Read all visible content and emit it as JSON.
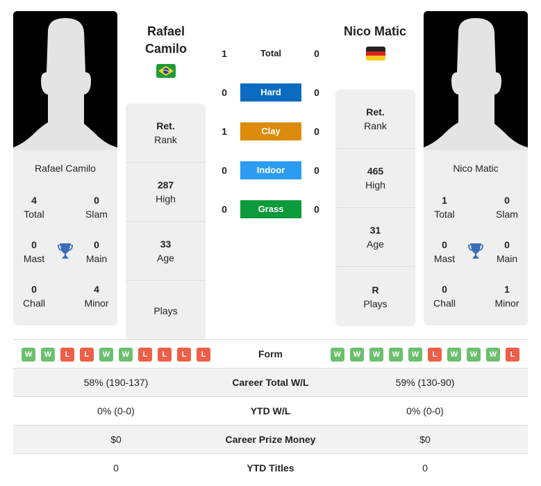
{
  "player1": {
    "name": "Rafael Camilo",
    "name_line1": "Rafael",
    "name_line2": "Camilo",
    "flag": "brazil-flag",
    "titles": {
      "total": "4",
      "total_label": "Total",
      "slam": "0",
      "slam_label": "Slam",
      "mast": "0",
      "mast_label": "Mast",
      "main": "0",
      "main_label": "Main",
      "chall": "0",
      "chall_label": "Chall",
      "minor": "4",
      "minor_label": "Minor"
    },
    "info": {
      "rank_value": "Ret.",
      "rank_label": "Rank",
      "high_value": "287",
      "high_label": "High",
      "age_value": "33",
      "age_label": "Age",
      "plays_value": "",
      "plays_label": "Plays"
    },
    "form": [
      "W",
      "W",
      "L",
      "L",
      "W",
      "W",
      "L",
      "L",
      "L",
      "L"
    ],
    "career_wl": "58% (190-137)",
    "ytd_wl": "0% (0-0)",
    "prize_money": "$0",
    "ytd_titles": "0"
  },
  "player2": {
    "name": "Nico Matic",
    "flag": "germany-flag",
    "titles": {
      "total": "1",
      "total_label": "Total",
      "slam": "0",
      "slam_label": "Slam",
      "mast": "0",
      "mast_label": "Mast",
      "main": "0",
      "main_label": "Main",
      "chall": "0",
      "chall_label": "Chall",
      "minor": "1",
      "minor_label": "Minor"
    },
    "info": {
      "rank_value": "Ret.",
      "rank_label": "Rank",
      "high_value": "465",
      "high_label": "High",
      "age_value": "31",
      "age_label": "Age",
      "plays_value": "R",
      "plays_label": "Plays"
    },
    "form": [
      "W",
      "W",
      "W",
      "W",
      "W",
      "L",
      "W",
      "W",
      "W",
      "L"
    ],
    "career_wl": "59% (130-90)",
    "ytd_wl": "0% (0-0)",
    "prize_money": "$0",
    "ytd_titles": "0"
  },
  "h2h": [
    {
      "label": "Total",
      "p1": "1",
      "p2": "0",
      "color": ""
    },
    {
      "label": "Hard",
      "p1": "0",
      "p2": "0",
      "color": "#0a6bc1"
    },
    {
      "label": "Clay",
      "p1": "1",
      "p2": "0",
      "color": "#dc8c0a"
    },
    {
      "label": "Indoor",
      "p1": "0",
      "p2": "0",
      "color": "#2b9cf2"
    },
    {
      "label": "Grass",
      "p1": "0",
      "p2": "0",
      "color": "#0c9a3a"
    }
  ],
  "table": {
    "form_label": "Form",
    "career_label": "Career Total W/L",
    "ytd_label": "YTD W/L",
    "prize_label": "Career Prize Money",
    "titles_label": "YTD Titles"
  },
  "colors": {
    "win": "#6cbf6f",
    "loss": "#ed5f48",
    "trophy": "#3a6fb7",
    "card_bg": "#efefef"
  }
}
